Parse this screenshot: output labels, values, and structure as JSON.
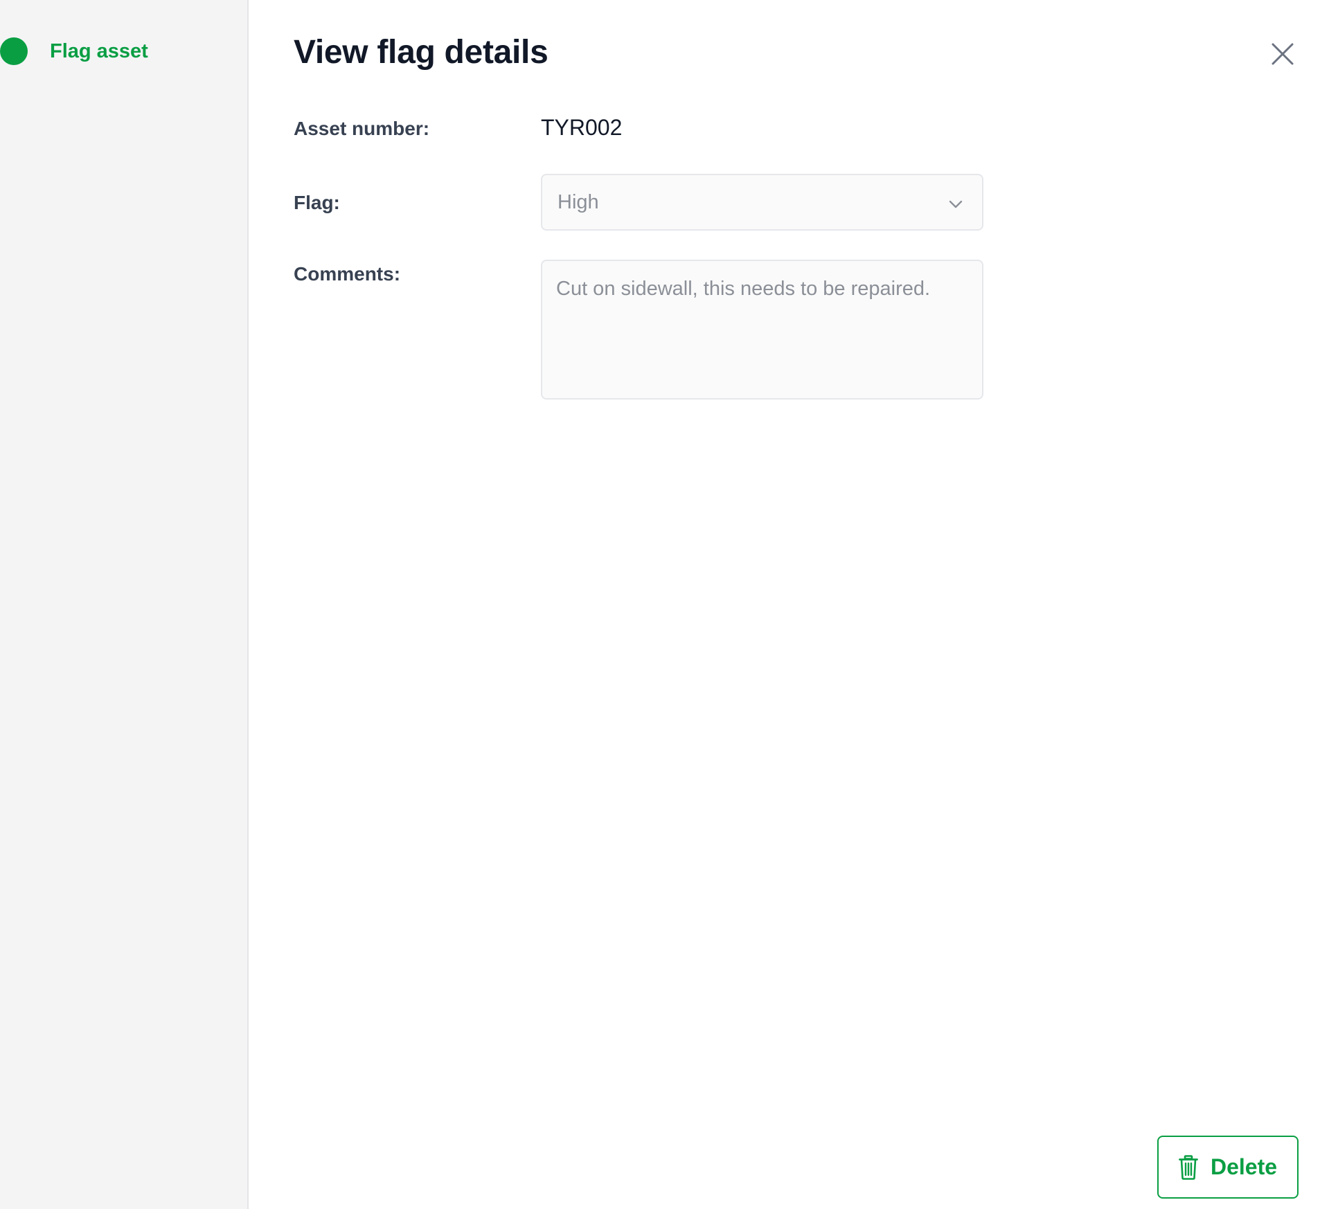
{
  "sidebar": {
    "step_label": "Flag asset",
    "step_color": "#0a9e43"
  },
  "header": {
    "title": "View flag details",
    "close_icon": "close-icon"
  },
  "form": {
    "asset_number_label": "Asset number:",
    "asset_number_value": "TYR002",
    "flag_label": "Flag:",
    "flag_value": "High",
    "comments_label": "Comments:",
    "comments_value": "Cut on sidewall, this needs to be repaired."
  },
  "footer": {
    "delete_label": "Delete",
    "delete_icon": "trash-icon"
  },
  "colors": {
    "accent": "#0a9e43",
    "title": "#111827",
    "label": "#374151",
    "muted_text": "#8b8f97"
  }
}
